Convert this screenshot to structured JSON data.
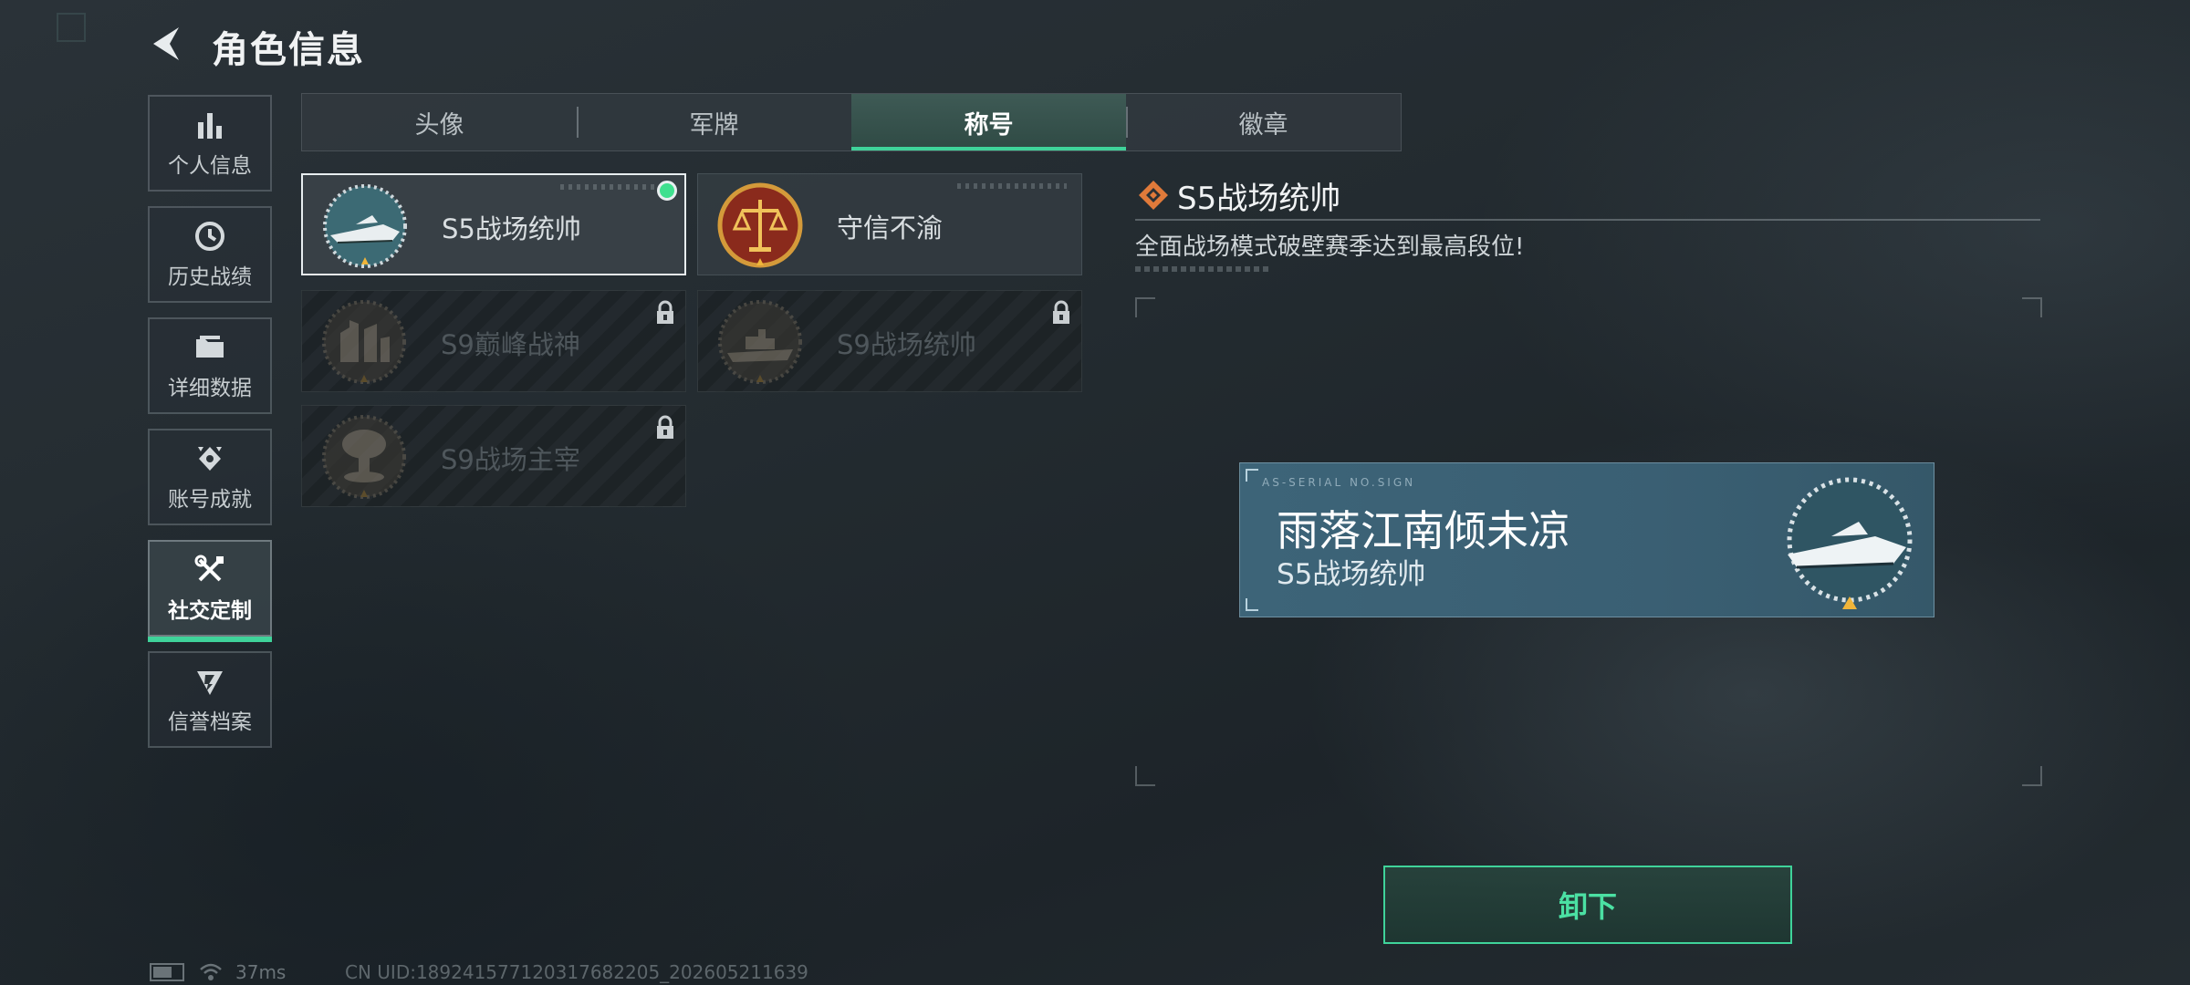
{
  "header": {
    "title": "角色信息"
  },
  "sidebar": {
    "items": [
      {
        "label": "个人信息",
        "icon": "bar-chart-icon",
        "active": false
      },
      {
        "label": "历史战绩",
        "icon": "clock-icon",
        "active": false
      },
      {
        "label": "详细数据",
        "icon": "folder-icon",
        "active": false
      },
      {
        "label": "账号成就",
        "icon": "achievement-icon",
        "active": false
      },
      {
        "label": "社交定制",
        "icon": "tools-icon",
        "active": true
      },
      {
        "label": "信誉档案",
        "icon": "shield-icon",
        "active": false
      }
    ]
  },
  "tabs": [
    {
      "label": "头像",
      "active": false
    },
    {
      "label": "军牌",
      "active": false
    },
    {
      "label": "称号",
      "active": true
    },
    {
      "label": "徽章",
      "active": false
    }
  ],
  "titles": [
    {
      "name": "S5战场统帅",
      "emblem": "speedboat-emblem",
      "selected": true,
      "equipped": true,
      "locked": false
    },
    {
      "name": "守信不渝",
      "emblem": "scales-emblem",
      "selected": false,
      "equipped": false,
      "locked": false
    },
    {
      "name": "S9巅峰战神",
      "emblem": "fortress-emblem",
      "selected": false,
      "equipped": false,
      "locked": true
    },
    {
      "name": "S9战场统帅",
      "emblem": "warship-emblem",
      "selected": false,
      "equipped": false,
      "locked": true
    },
    {
      "name": "S9战场主宰",
      "emblem": "mushroom-cloud-emblem",
      "selected": false,
      "equipped": false,
      "locked": true
    }
  ],
  "detail": {
    "title": "S5战场统帅",
    "description": "全面战场模式破壁赛季达到最高段位!"
  },
  "preview": {
    "player_name": "雨落江南倾未凉",
    "title": "S5战场统帅",
    "code": "AS-SERIAL NO.SIGN"
  },
  "actions": {
    "unequip_label": "卸下"
  },
  "status": {
    "ping": "37ms",
    "uid": "CN UID:18924157712031768​2205_202605211639"
  },
  "colors": {
    "accent": "#3fd39a",
    "equipped_dot": "#3fe08f",
    "preview_bg": "#3d6478"
  }
}
